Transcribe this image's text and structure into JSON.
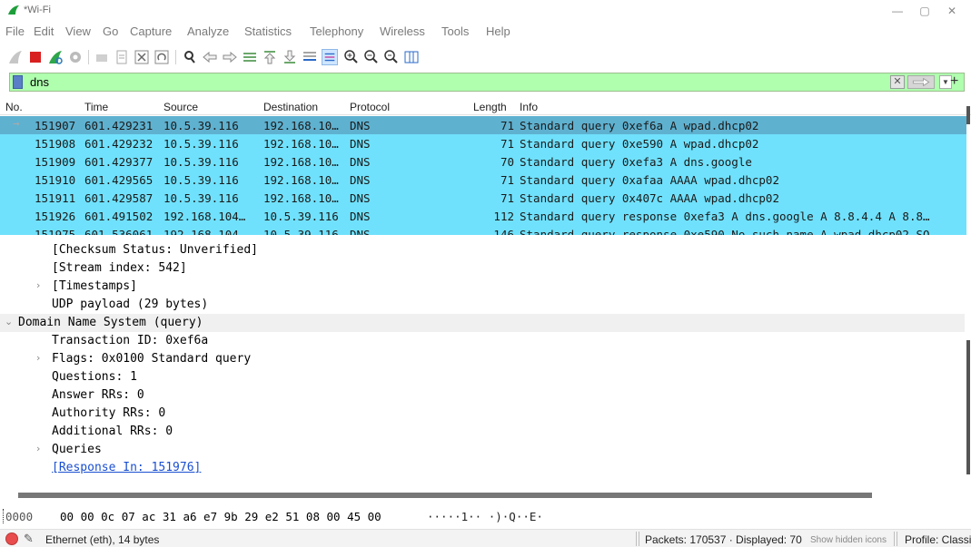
{
  "window": {
    "title": "*Wi-Fi",
    "minimize": "—",
    "maximize": "▢",
    "close": "✕"
  },
  "menu": [
    "File",
    "Edit",
    "View",
    "Go",
    "Capture",
    "Analyze",
    "Statistics",
    "Telephony",
    "Wireless",
    "Tools",
    "Help"
  ],
  "toolbar_icons": [
    "shark-fin-start-icon",
    "stop-capture-icon",
    "restart-capture-icon",
    "capture-options-icon",
    "open-file-icon",
    "save-file-icon",
    "close-file-icon",
    "reload-file-icon",
    "find-packet-icon",
    "go-back-icon",
    "go-forward-icon",
    "go-to-packet-icon",
    "go-first-packet-icon",
    "go-last-packet-icon",
    "autoscroll-icon",
    "colorize-icon",
    "zoom-in-icon",
    "zoom-out-icon",
    "zoom-normal-icon",
    "resize-columns-icon"
  ],
  "filter": {
    "value": "dns",
    "clear": "✕",
    "add": "+"
  },
  "packet_list": {
    "headers": [
      "No.",
      "Time",
      "Source",
      "Destination",
      "Protocol",
      "Length",
      "Info"
    ],
    "rows": [
      {
        "no": "151907",
        "time": "601.429231",
        "src": "10.5.39.116",
        "dst": "192.168.10…",
        "proto": "DNS",
        "len": "71",
        "info": "Standard query 0xef6a A wpad.dhcp02"
      },
      {
        "no": "151908",
        "time": "601.429232",
        "src": "10.5.39.116",
        "dst": "192.168.10…",
        "proto": "DNS",
        "len": "71",
        "info": "Standard query 0xe590 A wpad.dhcp02"
      },
      {
        "no": "151909",
        "time": "601.429377",
        "src": "10.5.39.116",
        "dst": "192.168.10…",
        "proto": "DNS",
        "len": "70",
        "info": "Standard query 0xefa3 A dns.google"
      },
      {
        "no": "151910",
        "time": "601.429565",
        "src": "10.5.39.116",
        "dst": "192.168.10…",
        "proto": "DNS",
        "len": "71",
        "info": "Standard query 0xafaa AAAA wpad.dhcp02"
      },
      {
        "no": "151911",
        "time": "601.429587",
        "src": "10.5.39.116",
        "dst": "192.168.10…",
        "proto": "DNS",
        "len": "71",
        "info": "Standard query 0x407c AAAA wpad.dhcp02"
      },
      {
        "no": "151926",
        "time": "601.491502",
        "src": "192.168.104…",
        "dst": "10.5.39.116",
        "proto": "DNS",
        "len": "112",
        "info": "Standard query response 0xefa3 A dns.google A 8.8.4.4 A 8.8…"
      },
      {
        "no": "151975",
        "time": "601.536061",
        "src": "192.168.104…",
        "dst": "10.5.39.116",
        "proto": "DNS",
        "len": "146",
        "info": "Standard query response 0xe590 No such name A wpad.dhcp02 SO"
      }
    ]
  },
  "details": {
    "lines": [
      {
        "text": "[Checksum Status: Unverified]",
        "indent": 2,
        "chevron": ""
      },
      {
        "text": "[Stream index: 542]",
        "indent": 2,
        "chevron": ""
      },
      {
        "text": "[Timestamps]",
        "indent": 2,
        "chevron": "›"
      },
      {
        "text": "UDP payload (29 bytes)",
        "indent": 2,
        "chevron": ""
      },
      {
        "text": "Domain Name System (query)",
        "indent": 0,
        "chevron": "⌄"
      },
      {
        "text": "Transaction ID: 0xef6a",
        "indent": 2,
        "chevron": ""
      },
      {
        "text": "Flags: 0x0100 Standard query",
        "indent": 2,
        "chevron": "›"
      },
      {
        "text": "Questions: 1",
        "indent": 2,
        "chevron": ""
      },
      {
        "text": "Answer RRs: 0",
        "indent": 2,
        "chevron": ""
      },
      {
        "text": "Authority RRs: 0",
        "indent": 2,
        "chevron": ""
      },
      {
        "text": "Additional RRs: 0",
        "indent": 2,
        "chevron": ""
      },
      {
        "text": "Queries",
        "indent": 2,
        "chevron": "›"
      },
      {
        "text": "[Response In: 151976]",
        "indent": 2,
        "chevron": "",
        "link": true
      }
    ]
  },
  "hex": {
    "offset": "0000",
    "bytes": "00 00 0c 07 ac 31 a6 e7  9b 29 e2 51 08 00 45 00",
    "ascii": "·····1·· ·)·Q··E·"
  },
  "status": {
    "field": "Ethernet (eth), 14 bytes",
    "packets": "Packets: 170537 · Displayed: 70",
    "hidden_icons": "Show hidden icons",
    "profile": "Profile: Classic"
  },
  "colors": {
    "row_bg": "#70e1fc",
    "row_selected": "#5fb1d0",
    "filter_bg": "#afffaf",
    "link": "#1a4fd1"
  }
}
